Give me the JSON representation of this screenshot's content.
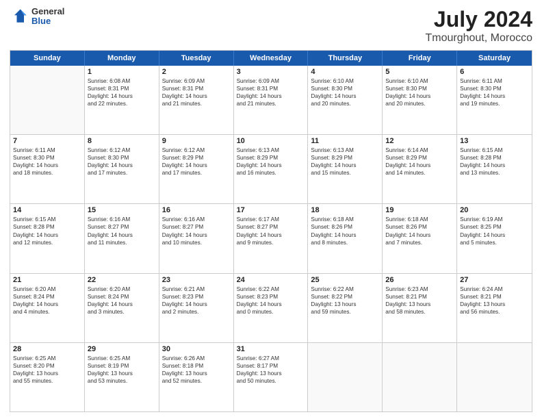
{
  "header": {
    "logo": {
      "general": "General",
      "blue": "Blue"
    },
    "title": "July 2024",
    "subtitle": "Tmourghout, Morocco"
  },
  "calendar": {
    "days": [
      "Sunday",
      "Monday",
      "Tuesday",
      "Wednesday",
      "Thursday",
      "Friday",
      "Saturday"
    ],
    "weeks": [
      [
        {
          "day": "",
          "data": []
        },
        {
          "day": "1",
          "data": [
            "Sunrise: 6:08 AM",
            "Sunset: 8:31 PM",
            "Daylight: 14 hours",
            "and 22 minutes."
          ]
        },
        {
          "day": "2",
          "data": [
            "Sunrise: 6:09 AM",
            "Sunset: 8:31 PM",
            "Daylight: 14 hours",
            "and 21 minutes."
          ]
        },
        {
          "day": "3",
          "data": [
            "Sunrise: 6:09 AM",
            "Sunset: 8:31 PM",
            "Daylight: 14 hours",
            "and 21 minutes."
          ]
        },
        {
          "day": "4",
          "data": [
            "Sunrise: 6:10 AM",
            "Sunset: 8:30 PM",
            "Daylight: 14 hours",
            "and 20 minutes."
          ]
        },
        {
          "day": "5",
          "data": [
            "Sunrise: 6:10 AM",
            "Sunset: 8:30 PM",
            "Daylight: 14 hours",
            "and 20 minutes."
          ]
        },
        {
          "day": "6",
          "data": [
            "Sunrise: 6:11 AM",
            "Sunset: 8:30 PM",
            "Daylight: 14 hours",
            "and 19 minutes."
          ]
        }
      ],
      [
        {
          "day": "7",
          "data": [
            "Sunrise: 6:11 AM",
            "Sunset: 8:30 PM",
            "Daylight: 14 hours",
            "and 18 minutes."
          ]
        },
        {
          "day": "8",
          "data": [
            "Sunrise: 6:12 AM",
            "Sunset: 8:30 PM",
            "Daylight: 14 hours",
            "and 17 minutes."
          ]
        },
        {
          "day": "9",
          "data": [
            "Sunrise: 6:12 AM",
            "Sunset: 8:29 PM",
            "Daylight: 14 hours",
            "and 17 minutes."
          ]
        },
        {
          "day": "10",
          "data": [
            "Sunrise: 6:13 AM",
            "Sunset: 8:29 PM",
            "Daylight: 14 hours",
            "and 16 minutes."
          ]
        },
        {
          "day": "11",
          "data": [
            "Sunrise: 6:13 AM",
            "Sunset: 8:29 PM",
            "Daylight: 14 hours",
            "and 15 minutes."
          ]
        },
        {
          "day": "12",
          "data": [
            "Sunrise: 6:14 AM",
            "Sunset: 8:29 PM",
            "Daylight: 14 hours",
            "and 14 minutes."
          ]
        },
        {
          "day": "13",
          "data": [
            "Sunrise: 6:15 AM",
            "Sunset: 8:28 PM",
            "Daylight: 14 hours",
            "and 13 minutes."
          ]
        }
      ],
      [
        {
          "day": "14",
          "data": [
            "Sunrise: 6:15 AM",
            "Sunset: 8:28 PM",
            "Daylight: 14 hours",
            "and 12 minutes."
          ]
        },
        {
          "day": "15",
          "data": [
            "Sunrise: 6:16 AM",
            "Sunset: 8:27 PM",
            "Daylight: 14 hours",
            "and 11 minutes."
          ]
        },
        {
          "day": "16",
          "data": [
            "Sunrise: 6:16 AM",
            "Sunset: 8:27 PM",
            "Daylight: 14 hours",
            "and 10 minutes."
          ]
        },
        {
          "day": "17",
          "data": [
            "Sunrise: 6:17 AM",
            "Sunset: 8:27 PM",
            "Daylight: 14 hours",
            "and 9 minutes."
          ]
        },
        {
          "day": "18",
          "data": [
            "Sunrise: 6:18 AM",
            "Sunset: 8:26 PM",
            "Daylight: 14 hours",
            "and 8 minutes."
          ]
        },
        {
          "day": "19",
          "data": [
            "Sunrise: 6:18 AM",
            "Sunset: 8:26 PM",
            "Daylight: 14 hours",
            "and 7 minutes."
          ]
        },
        {
          "day": "20",
          "data": [
            "Sunrise: 6:19 AM",
            "Sunset: 8:25 PM",
            "Daylight: 14 hours",
            "and 5 minutes."
          ]
        }
      ],
      [
        {
          "day": "21",
          "data": [
            "Sunrise: 6:20 AM",
            "Sunset: 8:24 PM",
            "Daylight: 14 hours",
            "and 4 minutes."
          ]
        },
        {
          "day": "22",
          "data": [
            "Sunrise: 6:20 AM",
            "Sunset: 8:24 PM",
            "Daylight: 14 hours",
            "and 3 minutes."
          ]
        },
        {
          "day": "23",
          "data": [
            "Sunrise: 6:21 AM",
            "Sunset: 8:23 PM",
            "Daylight: 14 hours",
            "and 2 minutes."
          ]
        },
        {
          "day": "24",
          "data": [
            "Sunrise: 6:22 AM",
            "Sunset: 8:23 PM",
            "Daylight: 14 hours",
            "and 0 minutes."
          ]
        },
        {
          "day": "25",
          "data": [
            "Sunrise: 6:22 AM",
            "Sunset: 8:22 PM",
            "Daylight: 13 hours",
            "and 59 minutes."
          ]
        },
        {
          "day": "26",
          "data": [
            "Sunrise: 6:23 AM",
            "Sunset: 8:21 PM",
            "Daylight: 13 hours",
            "and 58 minutes."
          ]
        },
        {
          "day": "27",
          "data": [
            "Sunrise: 6:24 AM",
            "Sunset: 8:21 PM",
            "Daylight: 13 hours",
            "and 56 minutes."
          ]
        }
      ],
      [
        {
          "day": "28",
          "data": [
            "Sunrise: 6:25 AM",
            "Sunset: 8:20 PM",
            "Daylight: 13 hours",
            "and 55 minutes."
          ]
        },
        {
          "day": "29",
          "data": [
            "Sunrise: 6:25 AM",
            "Sunset: 8:19 PM",
            "Daylight: 13 hours",
            "and 53 minutes."
          ]
        },
        {
          "day": "30",
          "data": [
            "Sunrise: 6:26 AM",
            "Sunset: 8:18 PM",
            "Daylight: 13 hours",
            "and 52 minutes."
          ]
        },
        {
          "day": "31",
          "data": [
            "Sunrise: 6:27 AM",
            "Sunset: 8:17 PM",
            "Daylight: 13 hours",
            "and 50 minutes."
          ]
        },
        {
          "day": "",
          "data": []
        },
        {
          "day": "",
          "data": []
        },
        {
          "day": "",
          "data": []
        }
      ]
    ]
  }
}
